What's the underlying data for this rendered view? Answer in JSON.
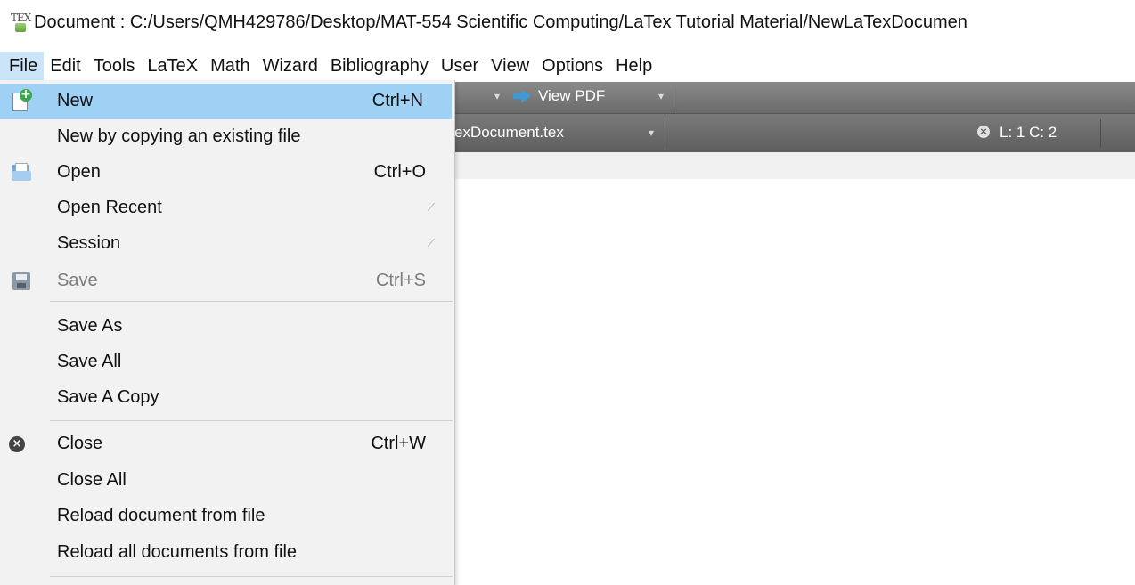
{
  "window": {
    "title": "Document : C:/Users/QMH429786/Desktop/MAT-554 Scientific Computing/LaTex Tutorial Material/NewLaTexDocumen",
    "app_icon_text": "TEX"
  },
  "menubar": {
    "items": [
      "File",
      "Edit",
      "Tools",
      "LaTeX",
      "Math",
      "Wizard",
      "Bibliography",
      "User",
      "View",
      "Options",
      "Help"
    ]
  },
  "toolbar": {
    "view_pdf_label": "View PDF"
  },
  "tabbar": {
    "tab_name": "exDocument.tex",
    "cursor_position": "L: 1 C: 2"
  },
  "file_menu": {
    "items": [
      {
        "label": "New",
        "shortcut": "Ctrl+N",
        "icon": "new-file-icon",
        "state": "highlighted"
      },
      {
        "label": "New by copying an existing file",
        "shortcut": ""
      },
      {
        "label": "Open",
        "shortcut": "Ctrl+O",
        "icon": "open-folder-icon"
      },
      {
        "label": "Open Recent",
        "shortcut": "",
        "submenu": true
      },
      {
        "label": "Session",
        "shortcut": "",
        "submenu": true
      },
      {
        "label": "Save",
        "shortcut": "Ctrl+S",
        "icon": "save-icon",
        "state": "disabled"
      },
      {
        "label": "Save As",
        "shortcut": ""
      },
      {
        "label": "Save All",
        "shortcut": ""
      },
      {
        "label": "Save A Copy",
        "shortcut": ""
      },
      {
        "label": "Close",
        "shortcut": "Ctrl+W",
        "icon": "close-icon"
      },
      {
        "label": "Close All",
        "shortcut": ""
      },
      {
        "label": "Reload document from file",
        "shortcut": ""
      },
      {
        "label": "Reload all documents from file",
        "shortcut": ""
      }
    ]
  },
  "colors": {
    "menu_highlight": "#9fd1f4",
    "menubar_active": "#cce4f7",
    "toolbar_bg": "#7a7a7a",
    "menu_bg": "#f2f2f2"
  }
}
